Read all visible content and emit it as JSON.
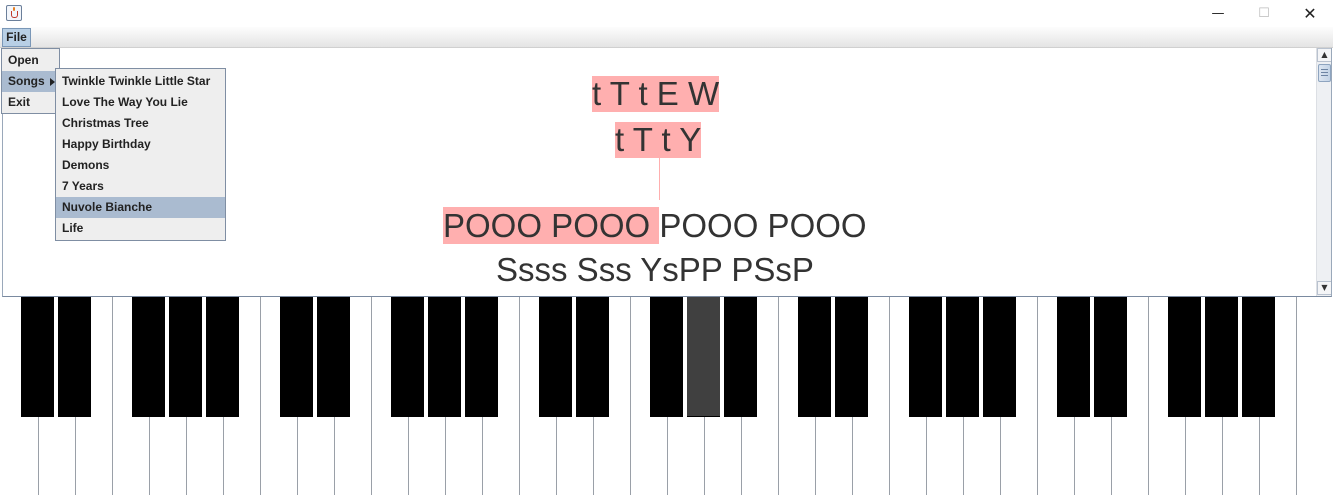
{
  "window": {
    "icon": "java-cup-icon",
    "controls": {
      "minimize": "—",
      "maximize": "☐",
      "close": "✕"
    }
  },
  "menubar": {
    "file_label": "File"
  },
  "file_menu": {
    "open_label": "Open",
    "songs_label": "Songs",
    "exit_label": "Exit"
  },
  "songs_menu": {
    "items": [
      "Twinkle Twinkle Little Star",
      "Love The Way You Lie",
      "Christmas Tree",
      "Happy Birthday",
      "Demons",
      "7 Years",
      "Nuvole Bianche",
      "Life"
    ],
    "selected": "Nuvole Bianche"
  },
  "sheet": {
    "line1": "t T t E W",
    "line2": "t T t Y",
    "line3_highlight": "POOO POOO ",
    "line3_rest": "POOO POOO",
    "line4": "Ssss Sss YsPP PSsP"
  },
  "piano": {
    "white_key_count": 36,
    "black_key_count": 25,
    "pressed_black_key": 13
  },
  "colors": {
    "highlight": "#ffafaf",
    "menu_selected": "#aabbd0",
    "pressed_key": "#404040"
  }
}
